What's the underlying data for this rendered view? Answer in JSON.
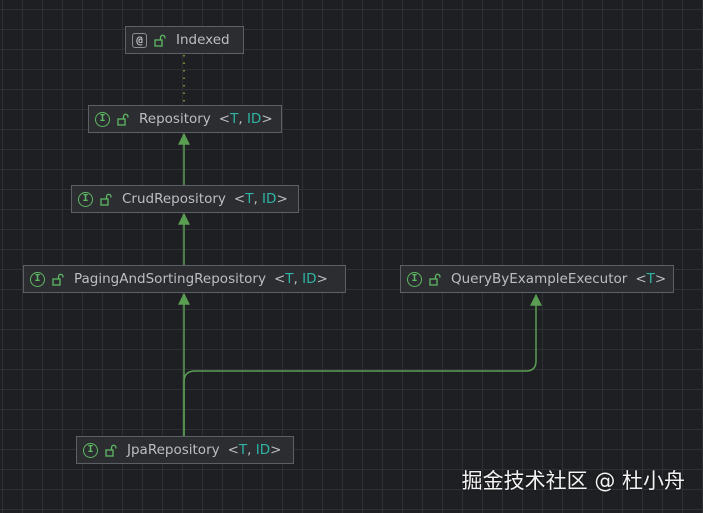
{
  "nodes": {
    "indexed": {
      "badge": "@",
      "name": "Indexed",
      "params": []
    },
    "repository": {
      "badge": "I",
      "name": "Repository",
      "params": [
        "T",
        "ID"
      ]
    },
    "crud": {
      "badge": "I",
      "name": "CrudRepository",
      "params": [
        "T",
        "ID"
      ]
    },
    "paging": {
      "badge": "I",
      "name": "PagingAndSortingRepository",
      "params": [
        "T",
        "ID"
      ]
    },
    "qbe": {
      "badge": "I",
      "name": "QueryByExampleExecutor",
      "params": [
        "T"
      ]
    },
    "jpa": {
      "badge": "I",
      "name": "JpaRepository",
      "params": [
        "T",
        "ID"
      ]
    }
  },
  "colors": {
    "background": "#1e1f22",
    "edge": "#5a9e53",
    "annotation_edge": "#a99e3c",
    "type_param": "#2fb5a6"
  },
  "icons": {
    "interface": "interface-icon",
    "annotation": "annotation-icon",
    "visibility": "open-lock-icon"
  },
  "watermark": "掘金技术社区 @ 杜小舟"
}
